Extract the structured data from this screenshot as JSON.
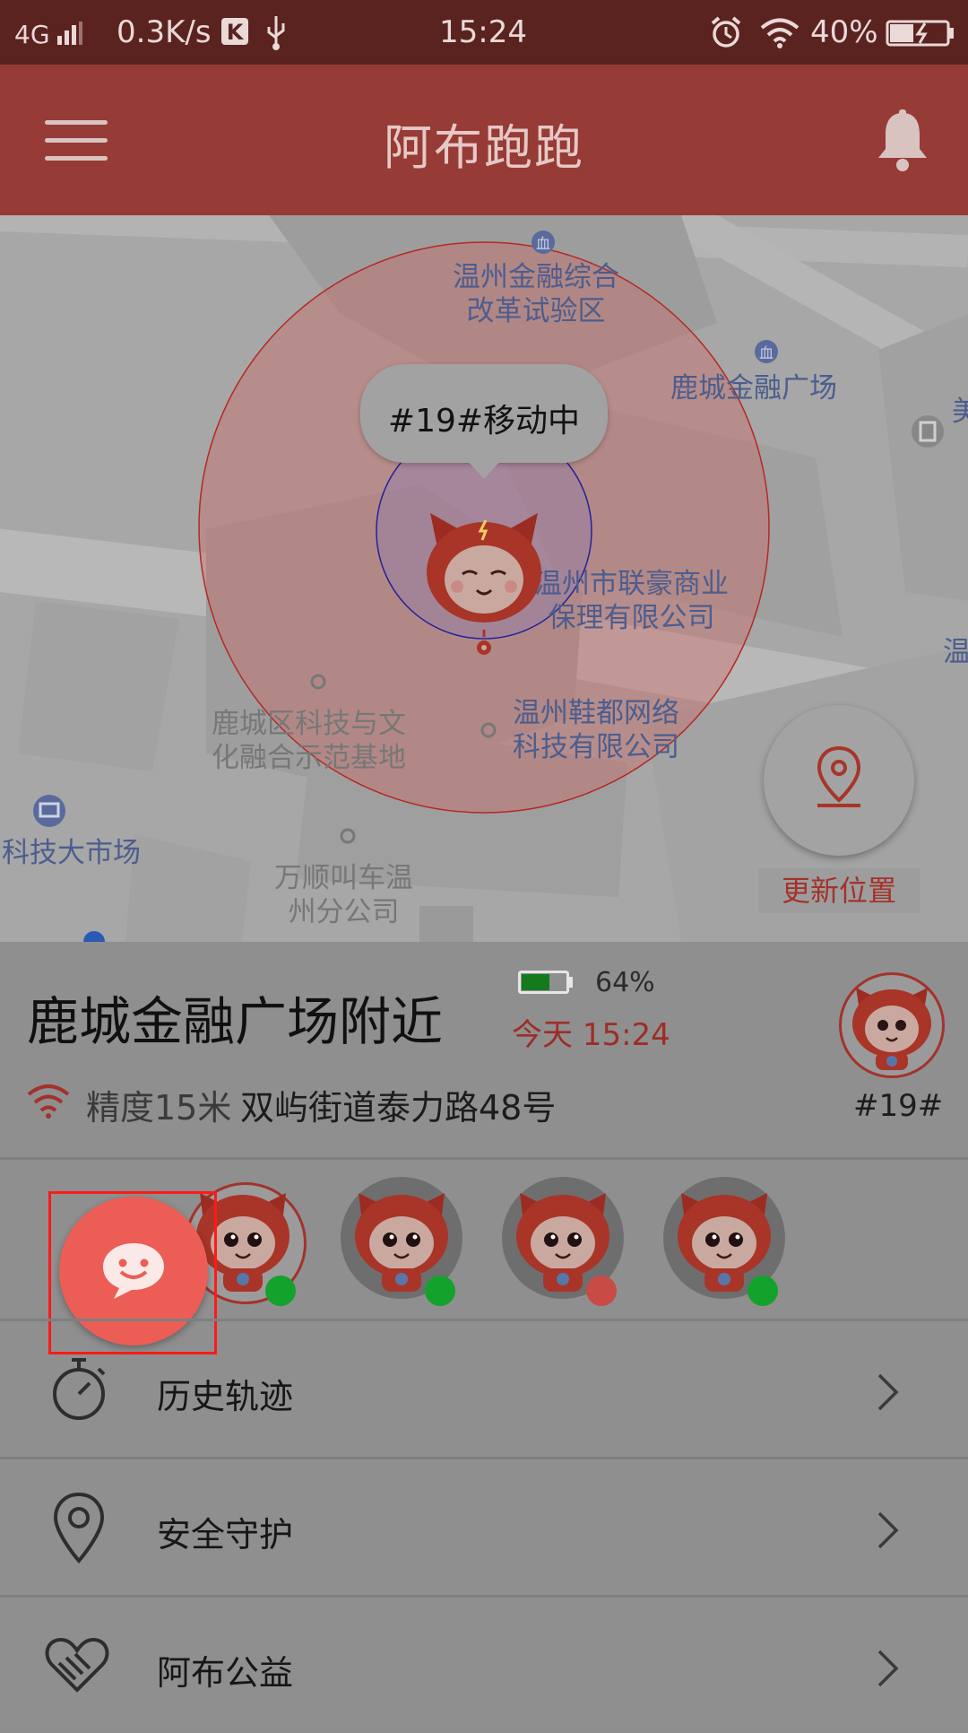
{
  "status_bar": {
    "network": "4G",
    "speed": "0.3K/s",
    "time": "15:24",
    "battery": "40%"
  },
  "app_bar": {
    "title": "阿布跑跑"
  },
  "map": {
    "bubble": "#19#移动中",
    "labels": {
      "finance_zone": [
        "温州金融综合",
        "改革试验区"
      ],
      "finance_plaza": "鹿城金融广场",
      "lianhao": [
        "温州市联豪商业",
        "保理有限公司"
      ],
      "xiedu": [
        "温州鞋都网络",
        "科技有限公司"
      ],
      "tech_base": [
        "鹿城区科技与文",
        "化融合示范基地"
      ],
      "tech_market": "科技大市场",
      "wanshun": [
        "万顺叫车温",
        "州分公司"
      ],
      "edge_right_1": "美",
      "edge_right_2": "温"
    },
    "update_location_label": "更新位置"
  },
  "info": {
    "location_name": "鹿城金融广场附近",
    "battery_pct": "64%",
    "battery_level": 0.64,
    "updated": "今天 15:24",
    "accuracy": "精度15米",
    "address": "双屿街道泰力路48号",
    "device_id": "#19#"
  },
  "devices": [
    {
      "status_color": "#13a22c"
    },
    {
      "status_color": "#13a22c"
    },
    {
      "status_color": "#c94b46"
    },
    {
      "status_color": "#13a22c"
    }
  ],
  "menu": [
    {
      "label": "历史轨迹",
      "icon": "stopwatch-icon"
    },
    {
      "label": "安全守护",
      "icon": "location-pin-icon"
    },
    {
      "label": "阿布公益",
      "icon": "heart-hand-icon"
    }
  ],
  "colors": {
    "accent": "#e8514a",
    "app_bar": "#963b36",
    "status_bar": "#5a2320"
  }
}
